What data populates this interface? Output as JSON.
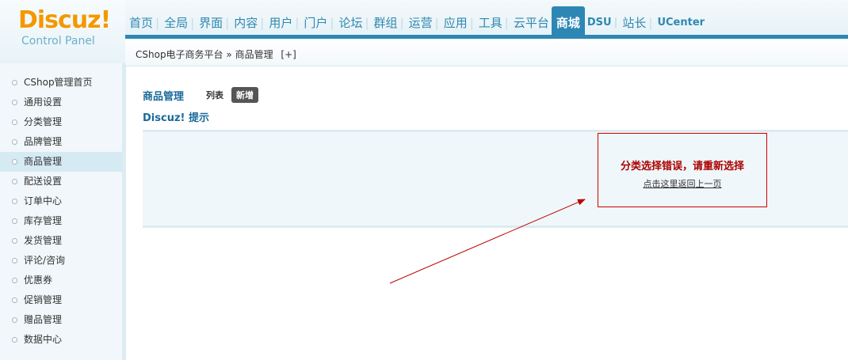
{
  "logo": {
    "brand": "Discuz!",
    "subtitle": "Control Panel"
  },
  "nav": {
    "tabs": [
      {
        "label": "首页"
      },
      {
        "label": "全局"
      },
      {
        "label": "界面"
      },
      {
        "label": "内容"
      },
      {
        "label": "用户"
      },
      {
        "label": "门户"
      },
      {
        "label": "论坛"
      },
      {
        "label": "群组"
      },
      {
        "label": "运营"
      },
      {
        "label": "应用"
      },
      {
        "label": "工具"
      },
      {
        "label": "云平台"
      },
      {
        "label": "商城",
        "active": true
      },
      {
        "label": "DSU"
      },
      {
        "label": "站长"
      },
      {
        "label": "UCenter"
      }
    ]
  },
  "breadcrumb": {
    "root": "CShop电子商务平台",
    "separator": "»",
    "current": "商品管理",
    "add": "[+]"
  },
  "sidebar": {
    "items": [
      {
        "label": "CShop管理首页"
      },
      {
        "label": "通用设置"
      },
      {
        "label": "分类管理"
      },
      {
        "label": "品牌管理"
      },
      {
        "label": "商品管理",
        "active": true
      },
      {
        "label": "配送设置"
      },
      {
        "label": "订单中心"
      },
      {
        "label": "库存管理"
      },
      {
        "label": "发货管理"
      },
      {
        "label": "评论/咨询"
      },
      {
        "label": "优惠券"
      },
      {
        "label": "促销管理"
      },
      {
        "label": "赠品管理"
      },
      {
        "label": "数据中心"
      }
    ]
  },
  "main": {
    "title": "商品管理",
    "list_link": "列表",
    "new_button": "新增",
    "tip_title": "Discuz! 提示",
    "error_message": "分类选择错误，请重新选择",
    "back_link": "点击这里返回上一页"
  },
  "colors": {
    "accent": "#2d87b5",
    "brand": "#f39800",
    "error": "#cc0000"
  }
}
